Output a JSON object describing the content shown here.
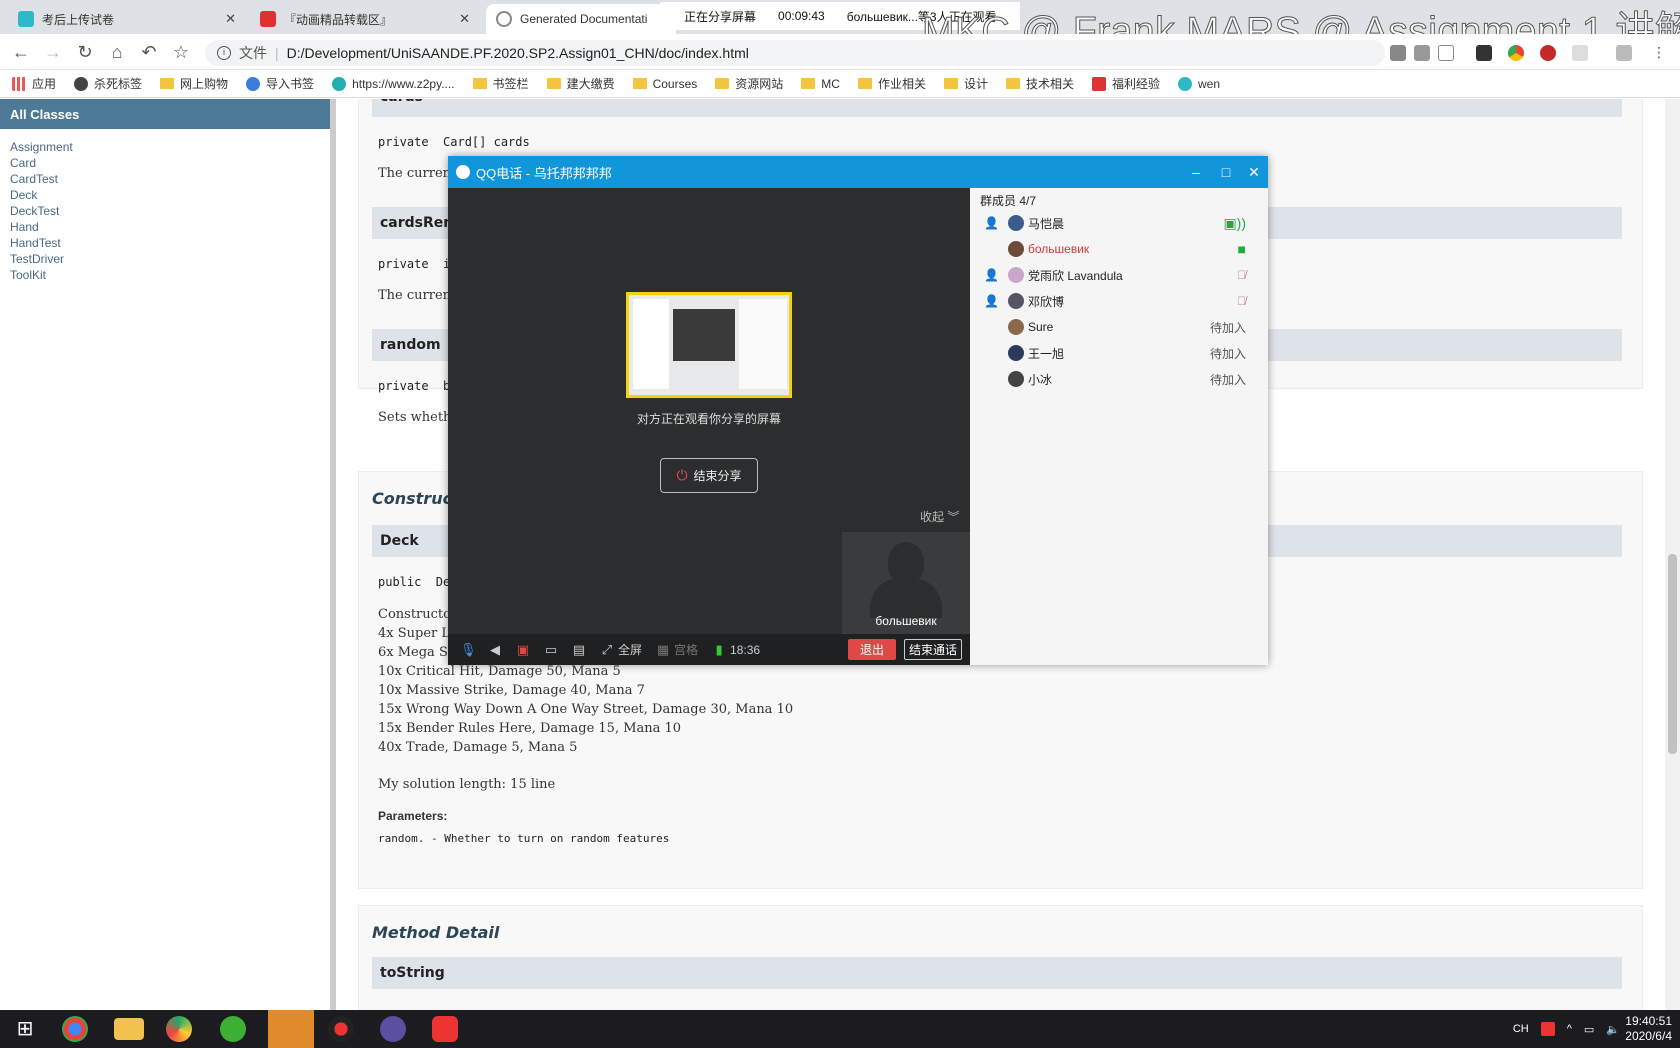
{
  "browser": {
    "tabs": [
      {
        "title": "考后上传试卷",
        "color": "#2eb8c8"
      },
      {
        "title": "『动画精品转载区』",
        "color": "#e03030"
      },
      {
        "title": "Generated Documentati",
        "color": "#888888"
      }
    ],
    "share_status": {
      "label": "正在分享屏幕",
      "timer": "00:09:43",
      "viewers": "большевик...等3人正在观看"
    },
    "watermark": "MKC @ Frank MARS @ Assignment 1 讲解",
    "url_scheme": "文件",
    "url": "D:/Development/UniSAANDE.PF.2020.SP2.Assign01_CHN/doc/index.html",
    "bookmarks": [
      {
        "label": "应用",
        "icon": "apps-grid-icon"
      },
      {
        "label": "杀死标签",
        "icon": "globe-icon"
      },
      {
        "label": "网上购物",
        "icon": "folder-icon"
      },
      {
        "label": "导入书签",
        "icon": "gear-icon"
      },
      {
        "label": "https://www.z2py....",
        "icon": "site-icon"
      },
      {
        "label": "书签栏",
        "icon": "folder-icon"
      },
      {
        "label": "建大缴费",
        "icon": "folder-icon"
      },
      {
        "label": "Courses",
        "icon": "folder-icon"
      },
      {
        "label": "资源网站",
        "icon": "folder-icon"
      },
      {
        "label": "MC",
        "icon": "folder-icon"
      },
      {
        "label": "作业相关",
        "icon": "folder-icon"
      },
      {
        "label": "设计",
        "icon": "folder-icon"
      },
      {
        "label": "技术相关",
        "icon": "folder-icon"
      },
      {
        "label": "福利经验",
        "icon": "site-icon"
      },
      {
        "label": "wen",
        "icon": "site-icon"
      }
    ]
  },
  "javadoc": {
    "all_classes": "All Classes",
    "classes": [
      "Assignment",
      "Card",
      "CardTest",
      "Deck",
      "DeckTest",
      "Hand",
      "HandTest",
      "TestDriver",
      "ToolKit"
    ],
    "fields": {
      "cards_header": "cards",
      "cards_sig": "private  Card[] cards",
      "cards_desc": "The curren",
      "cardsRemaining_header": "cardsRema",
      "cardsRemaining_sig": "private  i",
      "cardsRemaining_desc": "The curren",
      "random_header": "random",
      "random_sig": "private  b",
      "random_desc": "Sets whethe"
    },
    "constructor": {
      "section_title": "Construct",
      "header": "Deck",
      "sig": "public  De",
      "desc_lines": [
        "Constructo",
        "4x Super Li",
        "6x Mega Sa",
        "10x Critical Hit, Damage 50, Mana 5",
        "10x Massive Strike, Damage 40, Mana 7",
        "15x Wrong Way Down A One Way Street, Damage 30, Mana 10",
        "15x Bender Rules Here, Damage 15, Mana 10",
        "40x Trade, Damage 5, Mana 5"
      ],
      "solution": "My solution length: 15 line",
      "params_label": "Parameters:",
      "param": "random. - Whether to turn on random features"
    },
    "method_detail": {
      "section_title": "Method Detail",
      "header": "toString"
    }
  },
  "qq": {
    "title": "QQ电话 - 乌托邦邦邦邦",
    "watching": "对方正在观看你分享的屏幕",
    "end_share": "结束分享",
    "collapse": "收起",
    "self_name": "большевик",
    "controls": {
      "fullscreen": "全屏",
      "grid": "宫格",
      "signal_time": "18:36",
      "exit": "退出",
      "end_call": "结束通话"
    },
    "members_title": "群成员 4/7",
    "members": [
      {
        "name": "马恺晨",
        "host": true,
        "status": "",
        "status_icon": "screen-share-icon"
      },
      {
        "name": "большевик",
        "host": false,
        "status": "",
        "status_icon": "camera-icon",
        "highlight": "#d33a3a"
      },
      {
        "name": "党雨欣 Lavandula",
        "host": true,
        "status": "",
        "status_icon": "mic-muted-icon"
      },
      {
        "name": "邓欣博",
        "host": true,
        "status": "",
        "status_icon": "mic-muted-icon"
      },
      {
        "name": "Sure",
        "host": false,
        "status": "待加入",
        "status_icon": ""
      },
      {
        "name": "王一旭",
        "host": false,
        "status": "待加入",
        "status_icon": ""
      },
      {
        "name": "小冰",
        "host": false,
        "status": "待加入",
        "status_icon": ""
      }
    ]
  },
  "taskbar": {
    "tray_lang": "CH",
    "time": "19:40:51",
    "date": "2020/6/4"
  }
}
